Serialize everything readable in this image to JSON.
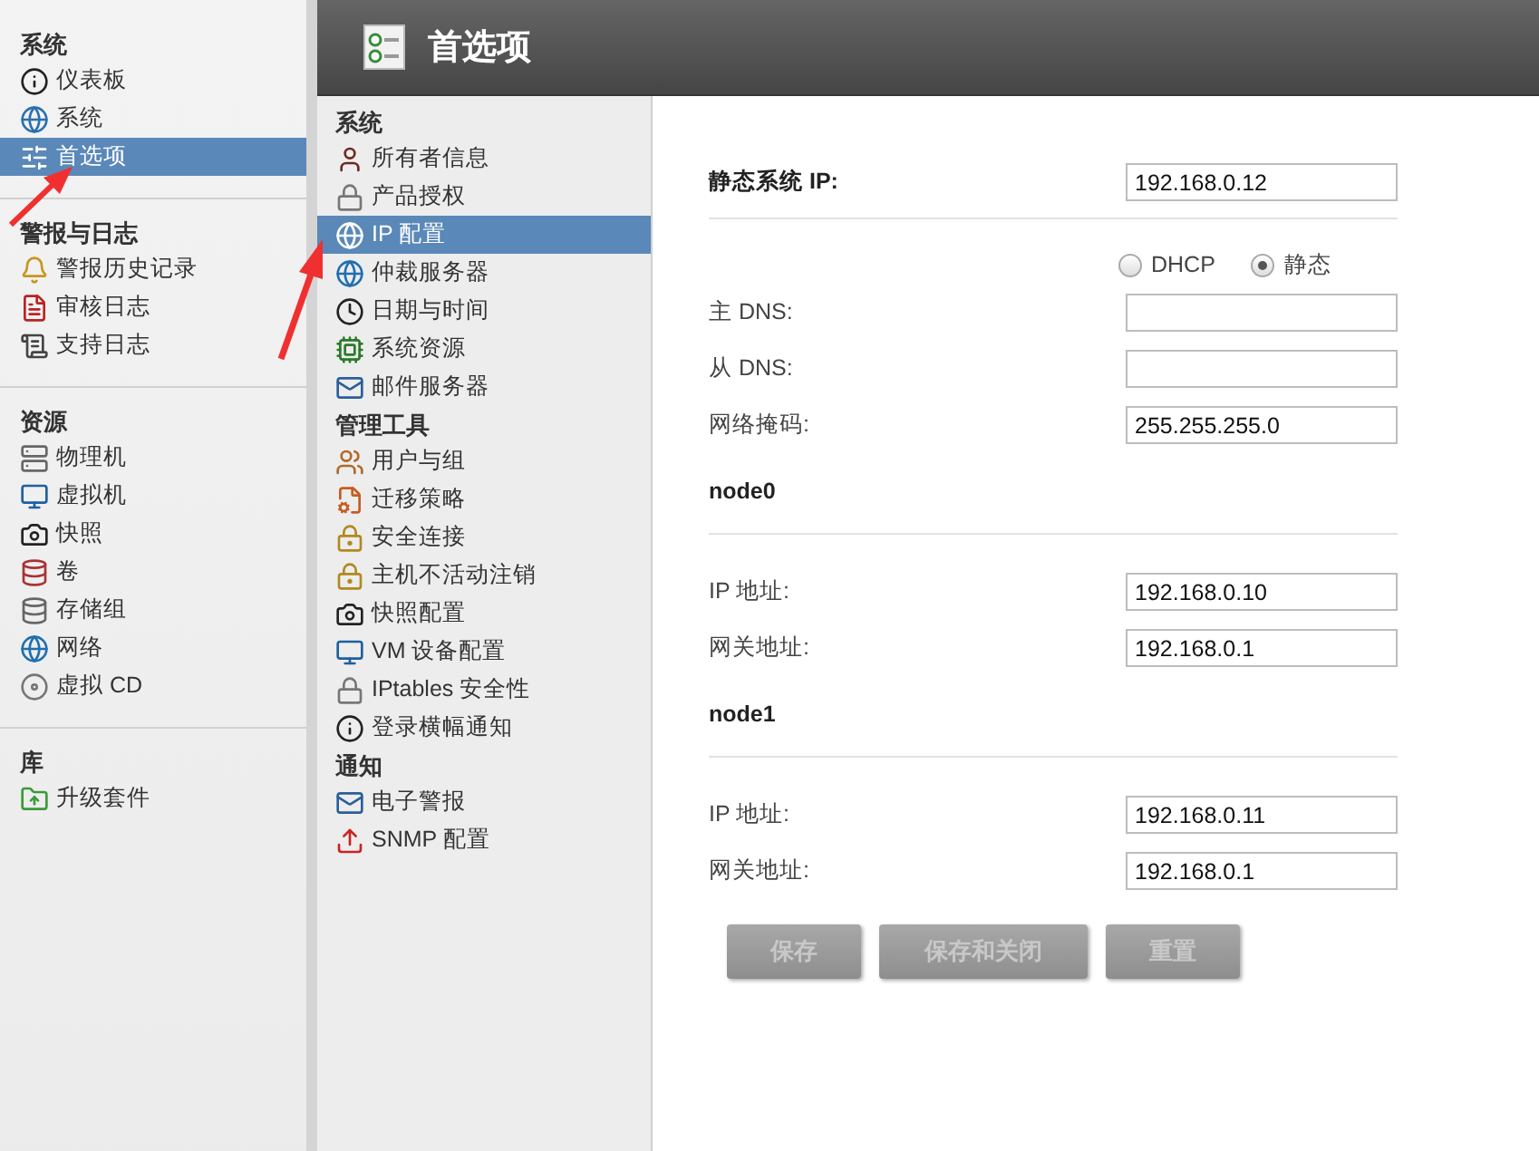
{
  "sidebar": {
    "sections": [
      {
        "heading": "系统",
        "items": [
          {
            "label": "仪表板",
            "selected": false
          },
          {
            "label": "系统",
            "selected": false
          },
          {
            "label": "首选项",
            "selected": true
          }
        ]
      },
      {
        "heading": "警报与日志",
        "items": [
          {
            "label": "警报历史记录",
            "selected": false
          },
          {
            "label": "审核日志",
            "selected": false
          },
          {
            "label": "支持日志",
            "selected": false
          }
        ]
      },
      {
        "heading": "资源",
        "items": [
          {
            "label": "物理机",
            "selected": false
          },
          {
            "label": "虚拟机",
            "selected": false
          },
          {
            "label": "快照",
            "selected": false
          },
          {
            "label": "卷",
            "selected": false
          },
          {
            "label": "存储组",
            "selected": false
          },
          {
            "label": "网络",
            "selected": false
          },
          {
            "label": "虚拟 CD",
            "selected": false
          }
        ]
      },
      {
        "heading": "库",
        "items": [
          {
            "label": "升级套件",
            "selected": false
          }
        ]
      }
    ]
  },
  "header": {
    "title": "首选项"
  },
  "submenu": {
    "sections": [
      {
        "heading": "系统",
        "items": [
          {
            "label": "所有者信息",
            "selected": false
          },
          {
            "label": "产品授权",
            "selected": false
          },
          {
            "label": "IP 配置",
            "selected": true
          },
          {
            "label": "仲裁服务器",
            "selected": false
          },
          {
            "label": "日期与时间",
            "selected": false
          },
          {
            "label": "系统资源",
            "selected": false
          },
          {
            "label": "邮件服务器",
            "selected": false
          }
        ]
      },
      {
        "heading": "管理工具",
        "items": [
          {
            "label": "用户与组",
            "selected": false
          },
          {
            "label": "迁移策略",
            "selected": false
          },
          {
            "label": "安全连接",
            "selected": false
          },
          {
            "label": "主机不活动注销",
            "selected": false
          },
          {
            "label": "快照配置",
            "selected": false
          },
          {
            "label": "VM 设备配置",
            "selected": false
          },
          {
            "label": "IPtables 安全性",
            "selected": false
          },
          {
            "label": "登录横幅通知",
            "selected": false
          }
        ]
      },
      {
        "heading": "通知",
        "items": [
          {
            "label": "电子警报",
            "selected": false
          },
          {
            "label": "SNMP 配置",
            "selected": false
          }
        ]
      }
    ]
  },
  "form": {
    "static_ip": {
      "label": "静态系统 IP:",
      "value": "192.168.0.12"
    },
    "mode_options": [
      {
        "label": "DHCP",
        "selected": false
      },
      {
        "label": "静态",
        "selected": true
      }
    ],
    "fields": [
      {
        "label": "主 DNS:"
      },
      {
        "label": "从 DNS:"
      },
      {
        "label": "网络掩码:",
        "value": "255.255.255.0"
      }
    ],
    "nodes": [
      {
        "name": "node0",
        "fields": [
          {
            "label": "IP 地址:",
            "value": "192.168.0.10"
          },
          {
            "label": "网关地址:",
            "value": "192.168.0.1"
          }
        ]
      },
      {
        "name": "node1",
        "fields": [
          {
            "label": "IP 地址:",
            "value": "192.168.0.11"
          },
          {
            "label": "网关地址:",
            "value": "192.168.0.1"
          }
        ]
      }
    ],
    "buttons": [
      {
        "label": "保存",
        "disabled": true
      },
      {
        "label": "保存和关闭",
        "disabled": true
      },
      {
        "label": "重置",
        "disabled": true
      }
    ]
  }
}
